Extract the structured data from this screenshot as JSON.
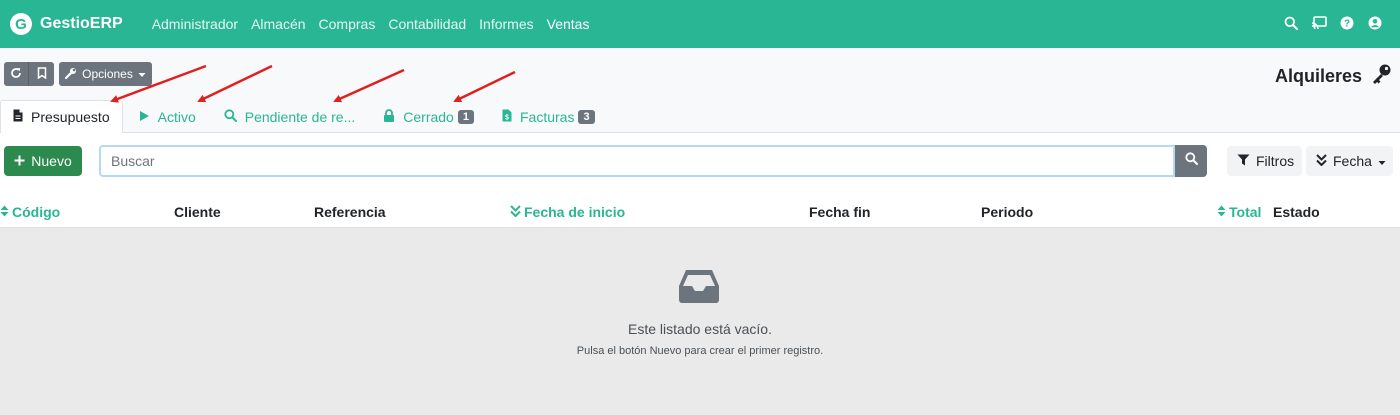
{
  "navbar": {
    "brand_letter": "G",
    "brand_name": "GestioERP",
    "menu": [
      "Administrador",
      "Almacén",
      "Compras",
      "Contabilidad",
      "Informes",
      "Ventas"
    ],
    "icons": [
      "search-icon",
      "cast-icon",
      "help-icon",
      "user-icon"
    ],
    "color": "#29b694"
  },
  "toolbar": {
    "options_label": "Opciones",
    "page_title": "Alquileres"
  },
  "tabs": [
    {
      "label": "Presupuesto",
      "icon": "file-icon",
      "active": true
    },
    {
      "label": "Activo",
      "icon": "play-icon"
    },
    {
      "label": "Pendiente de re...",
      "icon": "search-icon"
    },
    {
      "label": "Cerrado",
      "icon": "lock-icon",
      "badge": "1"
    },
    {
      "label": "Facturas",
      "icon": "invoice-icon",
      "badge": "3"
    }
  ],
  "actions": {
    "new_label": "Nuevo",
    "search_placeholder": "Buscar",
    "filters_label": "Filtros",
    "date_label": "Fecha"
  },
  "table": {
    "columns": [
      "Código",
      "Cliente",
      "Referencia",
      "Fecha de inicio",
      "Fecha fin",
      "Periodo",
      "Total",
      "Estado"
    ]
  },
  "empty_state": {
    "title": "Este listado está vacío.",
    "subtitle": "Pulsa el botón Nuevo para crear el primer registro."
  },
  "colors": {
    "accent": "#29b694",
    "new_button": "#2d8a4e",
    "annotation_arrow": "#e02020"
  }
}
